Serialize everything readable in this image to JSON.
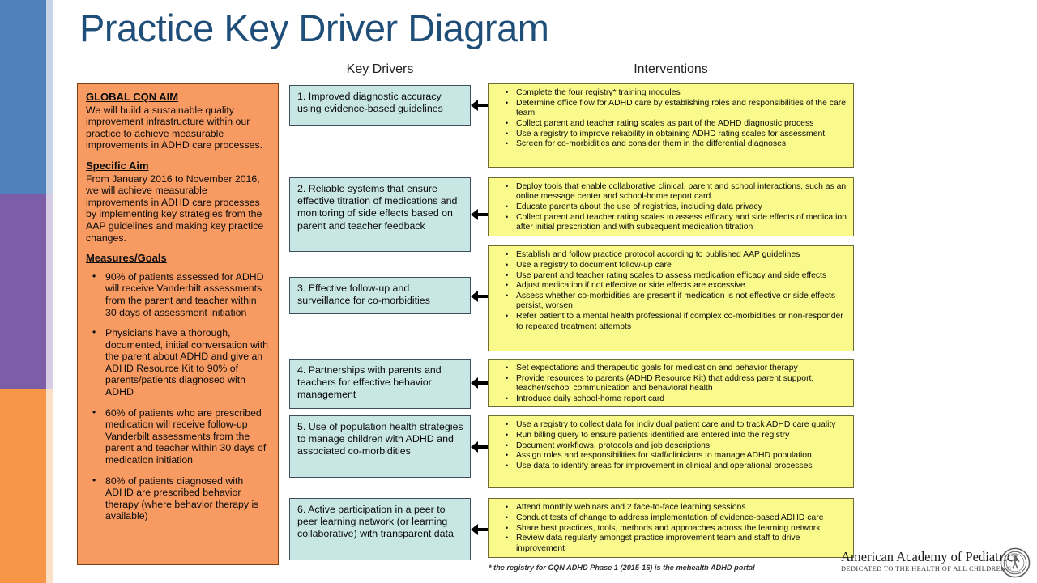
{
  "slide": {
    "title": "Practice Key Driver Diagram",
    "accent_blue": "#4f81bd",
    "accent_purple": "#7b5ea7",
    "accent_orange": "#f79646",
    "title_color": "#1f4e79",
    "aim_box_color": "#f79b63",
    "key_driver_box_color": "#c8e6e4",
    "intervention_box_color": "#fafa8c"
  },
  "headings": {
    "key_drivers": "Key Drivers",
    "interventions": "Interventions"
  },
  "aim_panel": {
    "global_aim_heading": "GLOBAL CQN AIM",
    "global_aim_text": "We will build a sustainable quality improvement infrastructure within our practice to achieve measurable improvements in ADHD care processes.",
    "specific_aim_heading": "Specific Aim",
    "specific_aim_text": "From January 2016 to November 2016, we will achieve measurable improvements in ADHD care processes by implementing key strategies from the AAP guidelines and making key practice changes.",
    "measures_heading": "Measures/Goals",
    "measures": [
      "90% of patients assessed for ADHD will receive Vanderbilt assessments from the parent and teacher within 30 days of assessment initiation",
      "Physicians have a thorough, documented, initial conversation with the parent about ADHD and give an ADHD Resource Kit to 90% of parents/patients diagnosed with ADHD",
      "60% of patients who are prescribed medication will receive follow-up Vanderbilt assessments from the parent and teacher within 30 days of medication initiation",
      "80% of patients diagnosed with ADHD are prescribed behavior therapy (where behavior therapy is available)"
    ]
  },
  "key_drivers": [
    {
      "text": "1. Improved diagnostic accuracy using evidence-based guidelines"
    },
    {
      "text": "2. Reliable systems that ensure effective titration of medications and monitoring of side effects based on parent and teacher feedback"
    },
    {
      "text": "3. Effective follow-up and surveillance for co-morbidities"
    },
    {
      "text": "4. Partnerships with parents and teachers for effective behavior management"
    },
    {
      "text": "5. Use of population health strategies to manage children with ADHD and associated co-morbidities"
    },
    {
      "text": "6. Active participation in a peer to peer learning network (or learning collaborative) with transparent data"
    }
  ],
  "interventions": [
    {
      "items": [
        "Complete the four registry* training modules",
        "Determine office flow for ADHD care by establishing roles and responsibilities of the care team",
        "Collect parent and teacher rating scales as part of the ADHD diagnostic process",
        "Use a registry to improve reliability in obtaining ADHD rating scales for assessment",
        "Screen for co-morbidities and consider them in the differential diagnoses"
      ]
    },
    {
      "items": [
        "Deploy tools that enable collaborative clinical, parent and school  interactions, such as an online message center and school-home report card",
        "Educate parents about the use of registries, including data privacy",
        "Collect parent and teacher rating scales to assess efficacy and side effects of medication after initial prescription and with subsequent medication titration"
      ]
    },
    {
      "items": [
        "Establish and follow practice protocol according to published AAP guidelines",
        "Use a registry to document follow-up care",
        "Use parent and teacher rating scales to assess medication efficacy and side effects",
        "Adjust medication if not effective or side effects are excessive",
        "Assess whether co-morbidities are present if medication is not effective or side effects persist, worsen",
        "Refer patient to a mental health professional if complex co-morbidities or non-responder to repeated treatment attempts"
      ]
    },
    {
      "items": [
        "Set expectations and therapeutic goals for medication and behavior therapy",
        "Provide resources to parents (ADHD Resource Kit) that address parent support, teacher/school communication and behavioral health",
        "Introduce daily school-home report card"
      ]
    },
    {
      "items": [
        "Use a registry to collect data for individual patient care and to track ADHD care quality",
        "Run billing query to ensure patients identified are entered into the registry",
        "Document workflows, protocols and job descriptions",
        "Assign roles and responsibilities for staff/clinicians to manage ADHD population",
        "Use data to identify areas for improvement in clinical and operational processes"
      ]
    },
    {
      "items": [
        "Attend monthly webinars and 2 face-to-face learning sessions",
        "Conduct tests of change to address implementation of evidence-based ADHD care",
        "Share best practices, tools, methods and approaches across the learning network",
        "Review data regularly amongst practice improvement team and staff to drive improvement"
      ]
    }
  ],
  "footnote": "* the registry for CQN ADHD Phase 1 (2015-16) is the mehealth ADHD portal",
  "logo": {
    "name": "American Academy of Pediatrics",
    "tagline": "DEDICATED TO THE HEALTH OF ALL CHILDREN®"
  }
}
